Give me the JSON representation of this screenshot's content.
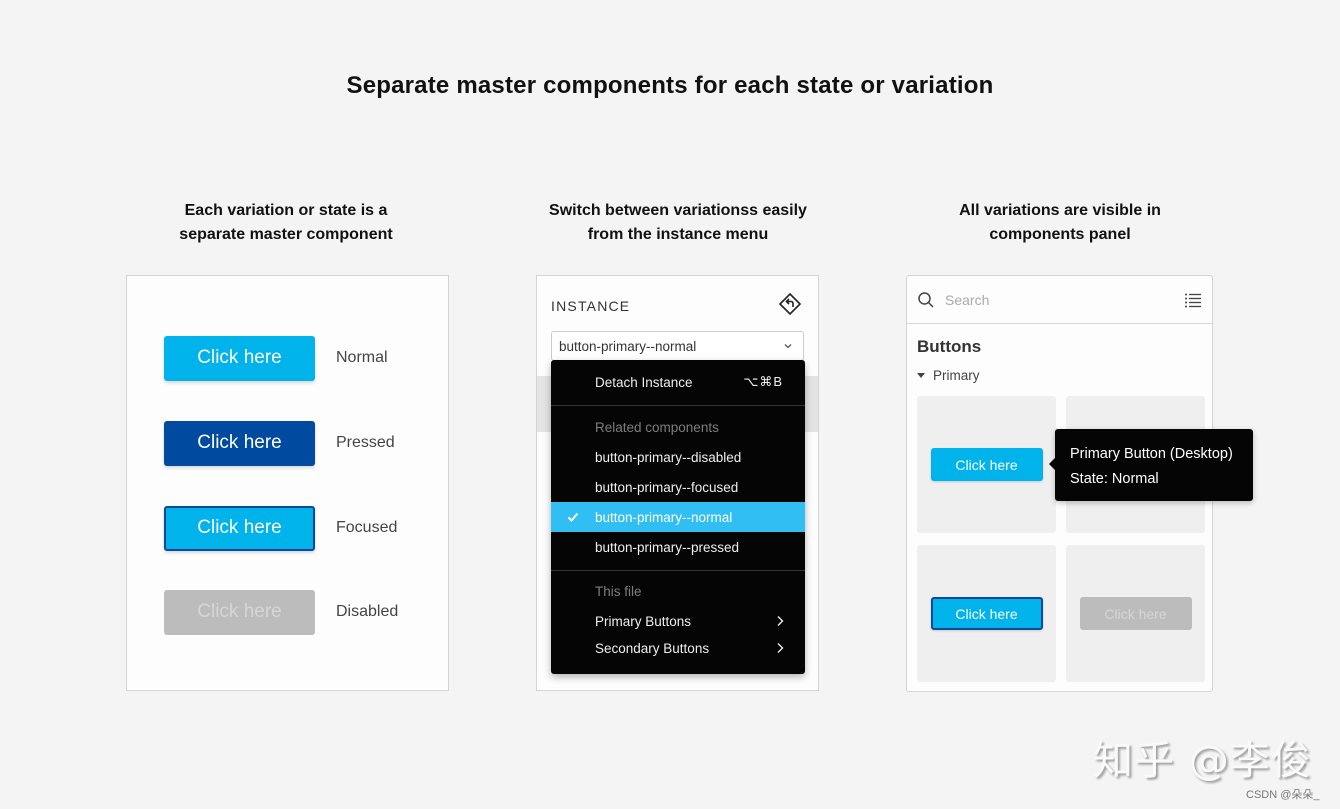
{
  "title": "Separate master components for each state or variation",
  "columns": [
    {
      "heading": [
        "Each variation or state is a",
        "separate master component"
      ]
    },
    {
      "heading": [
        "Switch between variationss easily",
        "from the instance menu"
      ]
    },
    {
      "heading": [
        "All variations are visible in",
        "components panel"
      ]
    }
  ],
  "states_panel": {
    "rows": [
      {
        "button_label": "Click here",
        "state": "Normal"
      },
      {
        "button_label": "Click here",
        "state": "Pressed"
      },
      {
        "button_label": "Click here",
        "state": "Focused"
      },
      {
        "button_label": "Click here",
        "state": "Disabled"
      }
    ]
  },
  "instance_panel": {
    "label": "INSTANCE",
    "icon": "instance-reset-icon",
    "selected_value": "button-primary--normal",
    "menu": {
      "detach": {
        "label": "Detach Instance",
        "shortcut": "⌥⌘B"
      },
      "related_header": "Related components",
      "related": [
        {
          "label": "button-primary--disabled",
          "selected": false
        },
        {
          "label": "button-primary--focused",
          "selected": false
        },
        {
          "label": "button-primary--normal",
          "selected": true
        },
        {
          "label": "button-primary--pressed",
          "selected": false
        }
      ],
      "file_header": "This file",
      "file_items": [
        {
          "label": "Primary Buttons",
          "has_submenu": true
        },
        {
          "label": "Secondary Buttons",
          "has_submenu": true
        }
      ]
    }
  },
  "components_panel": {
    "search_placeholder": "Search",
    "section_title": "Buttons",
    "group": "Primary",
    "tiles": [
      {
        "label": "Click here",
        "variant": "normal"
      },
      {
        "label": "",
        "variant": "empty"
      },
      {
        "label": "Click here",
        "variant": "focused"
      },
      {
        "label": "Click here",
        "variant": "disabled"
      }
    ],
    "tooltip": {
      "line1": "Primary Button (Desktop)",
      "line2": "State: Normal"
    }
  },
  "colors": {
    "primary": "#00b3ea",
    "pressed": "#004aa0",
    "focus_border": "#0a4a98",
    "disabled": "#bcbcbc",
    "menu_highlight": "#31bff3"
  },
  "watermark": "知乎 @李俊",
  "credit": "CSDN @朵朵_"
}
